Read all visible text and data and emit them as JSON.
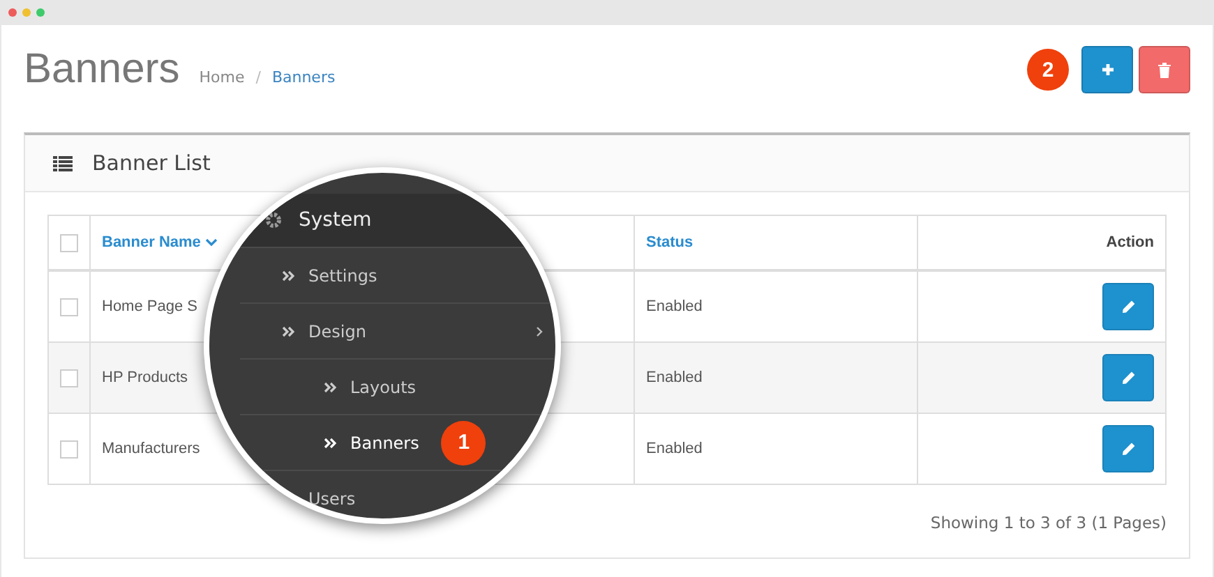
{
  "page": {
    "title": "Banners",
    "separator": "/",
    "breadcrumb": [
      {
        "label": "Home",
        "current": false
      },
      {
        "label": "Banners",
        "current": true
      }
    ]
  },
  "callouts": [
    {
      "label": "2"
    }
  ],
  "toolbar": [
    {
      "kind": "add"
    },
    {
      "kind": "delete"
    }
  ],
  "panel": {
    "title": "Banner List",
    "table": {
      "columns": [
        {
          "kind": "check",
          "checked": false
        },
        {
          "label": "Banner Name",
          "sorted": true
        },
        {
          "label": "Status"
        },
        {
          "label": "Action"
        }
      ],
      "rows": [
        {
          "checked": false,
          "name": "Home Page S",
          "status": "Enabled"
        },
        {
          "checked": false,
          "name": "HP Products",
          "status": "Enabled"
        },
        {
          "checked": false,
          "name": "Manufacturers",
          "status": "Enabled"
        }
      ]
    },
    "footer": "Showing 1 to 3 of 3 (1 Pages)"
  },
  "magnifier": {
    "title": "System",
    "items": [
      {
        "label": "Settings",
        "selected": false
      },
      {
        "label": "Design",
        "selected": false,
        "expanded": true,
        "children": [
          {
            "label": "Layouts",
            "selected": false
          },
          {
            "label": "Banners",
            "selected": true,
            "badge": "1"
          }
        ]
      },
      {
        "label": "Users",
        "selected": false
      }
    ]
  }
}
